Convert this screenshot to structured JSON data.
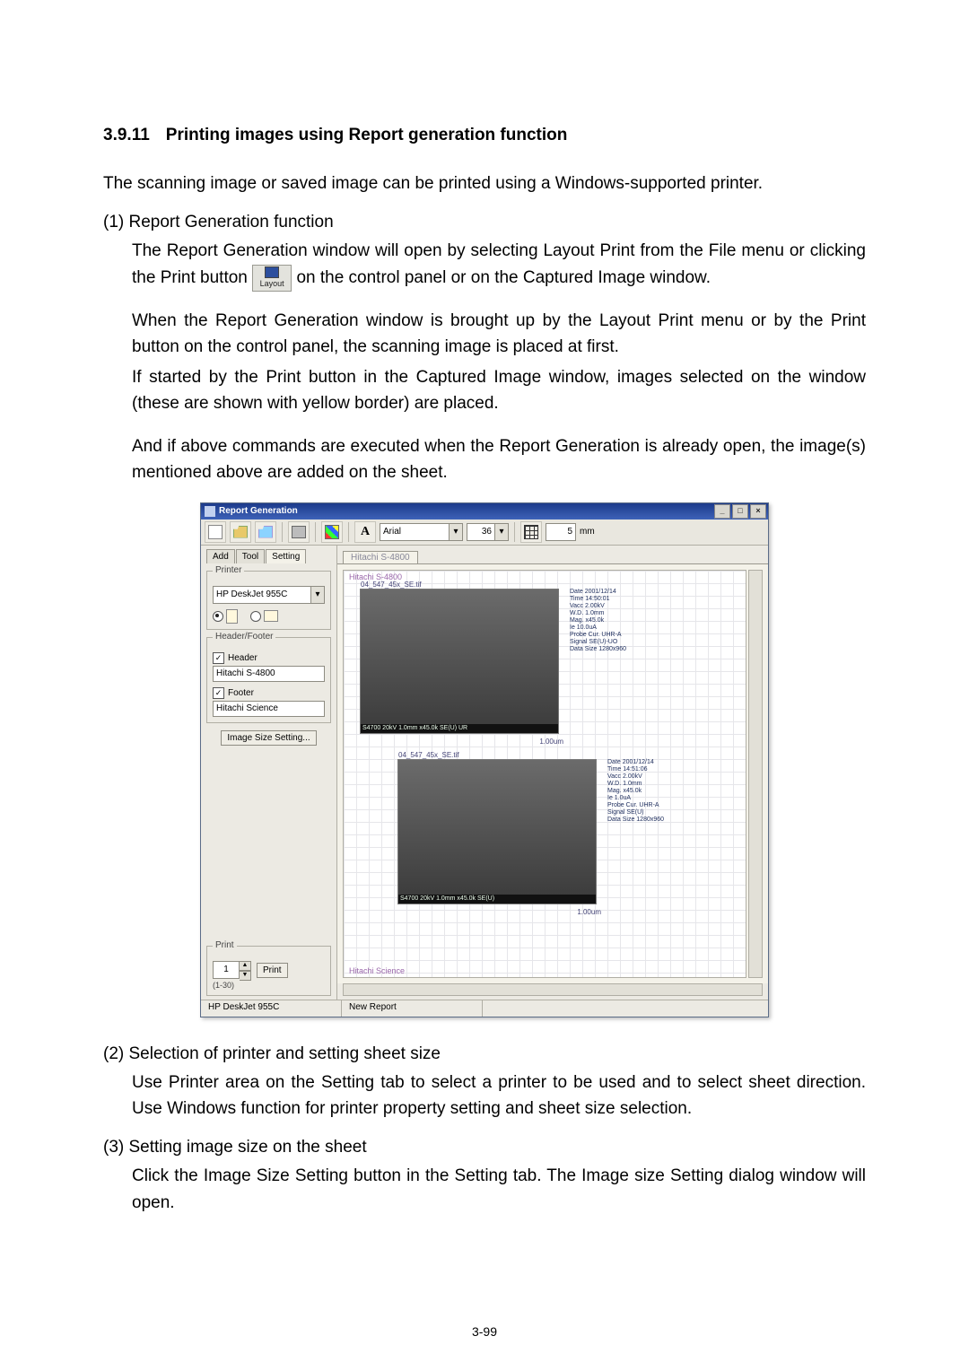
{
  "doc": {
    "heading_num": "3.9.11",
    "heading_text": "Printing images using Report generation function",
    "p0": "The scanning image or saved image can be printed using a Windows-supported printer.",
    "s1_label": "(1) Report Generation function",
    "s1_a_pre": "The Report Generation window will open by selecting Layout Print from the File menu or clicking the Print button ",
    "s1_a_post": " on the control panel or on the Captured Image window.",
    "layout_btn": "Layout",
    "s1_b": "When the Report Generation window is brought up by the Layout Print menu or by the Print button on the control panel, the scanning image is placed at first.",
    "s1_c": "If started by the Print button in the Captured Image window, images selected on the window (these are shown with yellow border) are placed.",
    "s1_d": "And if above commands are executed when the Report Generation is already open, the image(s) mentioned above are added on the sheet.",
    "s2_label": "(2) Selection of printer and setting sheet size",
    "s2_a": "Use Printer area on the Setting tab to select a printer to be used and to select sheet direction. Use Windows function for printer property setting and sheet size selection.",
    "s3_label": "(3) Setting image size on the sheet",
    "s3_a": "Click the Image Size Setting button in the Setting tab. The Image size Setting dialog window will open.",
    "page_num": "3-99"
  },
  "rg": {
    "title": "Report Generation",
    "toolbar": {
      "font_name": "Arial",
      "font_size": "36",
      "grid_val": "5",
      "grid_unit": "mm"
    },
    "tabs": {
      "add": "Add",
      "tool": "Tool",
      "setting": "Setting"
    },
    "printer": {
      "legend": "Printer",
      "selected": "HP DeskJet 955C"
    },
    "hf": {
      "legend": "Header/Footer",
      "header_chk": "Header",
      "header_val": "Hitachi S-4800",
      "footer_chk": "Footer",
      "footer_val": "Hitachi Science"
    },
    "image_size_btn": "Image Size Setting...",
    "print": {
      "legend": "Print",
      "copies": "1",
      "range": "(1-30)",
      "btn": "Print"
    },
    "status": {
      "printer": "HP DeskJet 955C",
      "report": "New Report"
    },
    "sheet": {
      "tab": "Hitachi S-4800",
      "header": "Hitachi S-4800",
      "footer": "Hitachi Science",
      "img1_caption": "04_547_45x_SE.tif",
      "img1_bar": "S4700 20kV 1.0mm x45.0k SE(U) UR",
      "img1_scale": "1.00um",
      "img2_caption": "04_547_45x_SE.tif",
      "img2_bar": "S4700 20kV 1.0mm x45.0k SE(U)",
      "img2_scale": "1.00um",
      "meta1": "Date 2001/12/14\nTime 14:50:01\nVacc 2.00kV\nW.D. 1.0mm\nMag. x45.0k\nIe 10.0uA\nProbe Cur. UHR-A\nSignal SE(U)-UO\nData Size 1280x960",
      "meta2": "Date 2001/12/14\nTime 14:51:06\nVacc 2.00kV\nW.D. 1.0mm\nMag. x45.0k\nIe 1.0uA\nProbe Cur. UHR-A\nSignal SE(U)\nData Size 1280x960"
    }
  }
}
